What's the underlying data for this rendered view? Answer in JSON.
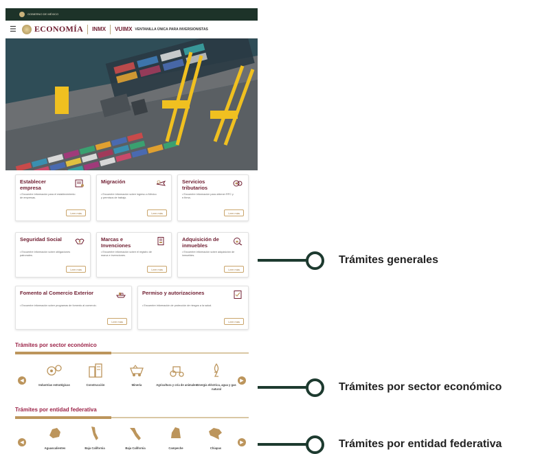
{
  "header": {
    "gov_text": "GOBIERNO DE MÉXICO",
    "economia": "ECONOMÍA",
    "inmx": "INMX",
    "vuimx": "VUIMX",
    "vu_title": "VENTANILLA ÚNICA PARA INVERSIONISTAS",
    "menu_icon": "hamburger-icon"
  },
  "cards": [
    {
      "title": "Establecer empresa",
      "desc": "• Encuentre información para el establecimiento de empresas.",
      "icon": "document-icon"
    },
    {
      "title": "Migración",
      "desc": "• Encuentre información sobre ingreso a México y permisos de trabajo.",
      "icon": "airplane-icon"
    },
    {
      "title": "Servicios tributarios",
      "desc": "• Encuentre información para obtener RFC y e.firma.",
      "icon": "coins-icon"
    },
    {
      "title": "Seguridad Social",
      "desc": "• Encuentre información sobre obligaciones patronales.",
      "icon": "handshake-icon"
    },
    {
      "title": "Marcas e Invenciones",
      "desc": "• Encuentre información sobre el registro de marca e invenciones.",
      "icon": "trademark-icon"
    },
    {
      "title": "Adquisición de inmuebles",
      "desc": "• Encuentre información sobre adquisición de inmuebles.",
      "icon": "house-search-icon"
    },
    {
      "title": "Fomento al Comercio Exterior",
      "desc": "• Encuentre información sobre programas de fomento al comercio.",
      "icon": "ship-icon"
    },
    {
      "title": "Permiso y autorizaciones",
      "desc": "• Encuentre información de protección de riesgos a la salud.",
      "icon": "checklist-icon"
    }
  ],
  "read_more": "Leer más",
  "sector": {
    "title": "Trámites por sector económico",
    "items": [
      "Industrias estratégicas",
      "Construcción",
      "Minería",
      "Agricultura y cría de animales",
      "Energía eléctrica, agua y gas natural"
    ]
  },
  "entidad": {
    "title": "Trámites por entidad federativa",
    "items": [
      "Aguascalientes",
      "Baja California",
      "Baja California",
      "Campeche",
      "Chiapas"
    ]
  },
  "callouts": [
    "Trámites generales",
    "Trámites por sector económico",
    "Trámites por entidad federativa"
  ],
  "colors": {
    "primary": "#6f1d30",
    "accent": "#bc955c",
    "dark": "#1d3a2f"
  }
}
